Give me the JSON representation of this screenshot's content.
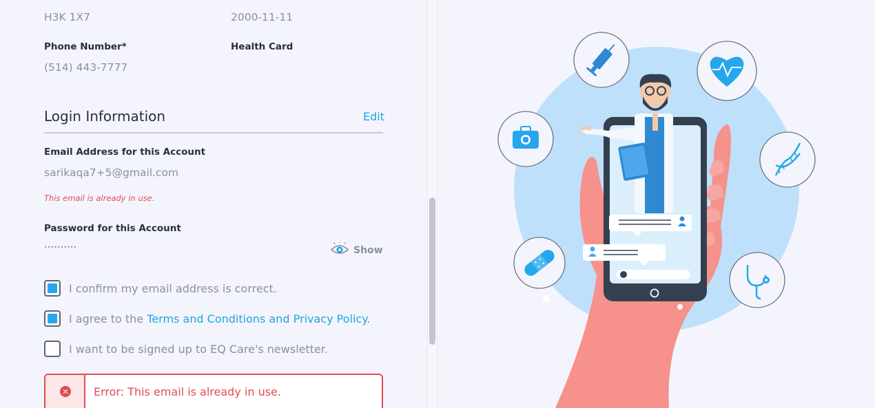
{
  "profile": {
    "postal_code_value": "H3K 1X7",
    "birthdate_value": "2000-11-11",
    "phone_label": "Phone Number*",
    "phone_value": "(514) 443-7777",
    "health_card_label": "Health Card"
  },
  "login": {
    "section_title": "Login Information",
    "edit_label": "Edit",
    "email_label": "Email Address for this Account",
    "email_value": "sarikaqa7+5@gmail.com",
    "email_error": "This email is already in use.",
    "password_label": "Password for this Account",
    "password_value": "••••••••••",
    "show_label": "Show"
  },
  "checkboxes": [
    {
      "text": "I confirm my email address is correct.",
      "checked": true
    },
    {
      "text_before": "I agree to the ",
      "link_text": "Terms and Conditions and Privacy Policy",
      "text_after": ".",
      "checked": true
    },
    {
      "text": "I want to be signed up to EQ Care's newsletter.",
      "checked": false
    }
  ],
  "error_banner": {
    "icon": "close-icon",
    "text": "Error: This email is already in use."
  },
  "colors": {
    "accent": "#1aa6e0",
    "error": "#e24b55",
    "checkbox_fill": "#25a6ee",
    "background": "#f4f5fc",
    "illustration_circle": "#bfe0fb",
    "hand": "#f6918c"
  },
  "illustration_icons": [
    "syringe-icon",
    "heart-pulse-icon",
    "first-aid-kit-icon",
    "dna-icon",
    "bandage-icon",
    "stethoscope-icon",
    "doctor-icon",
    "smartphone-icon",
    "hand-icon"
  ]
}
